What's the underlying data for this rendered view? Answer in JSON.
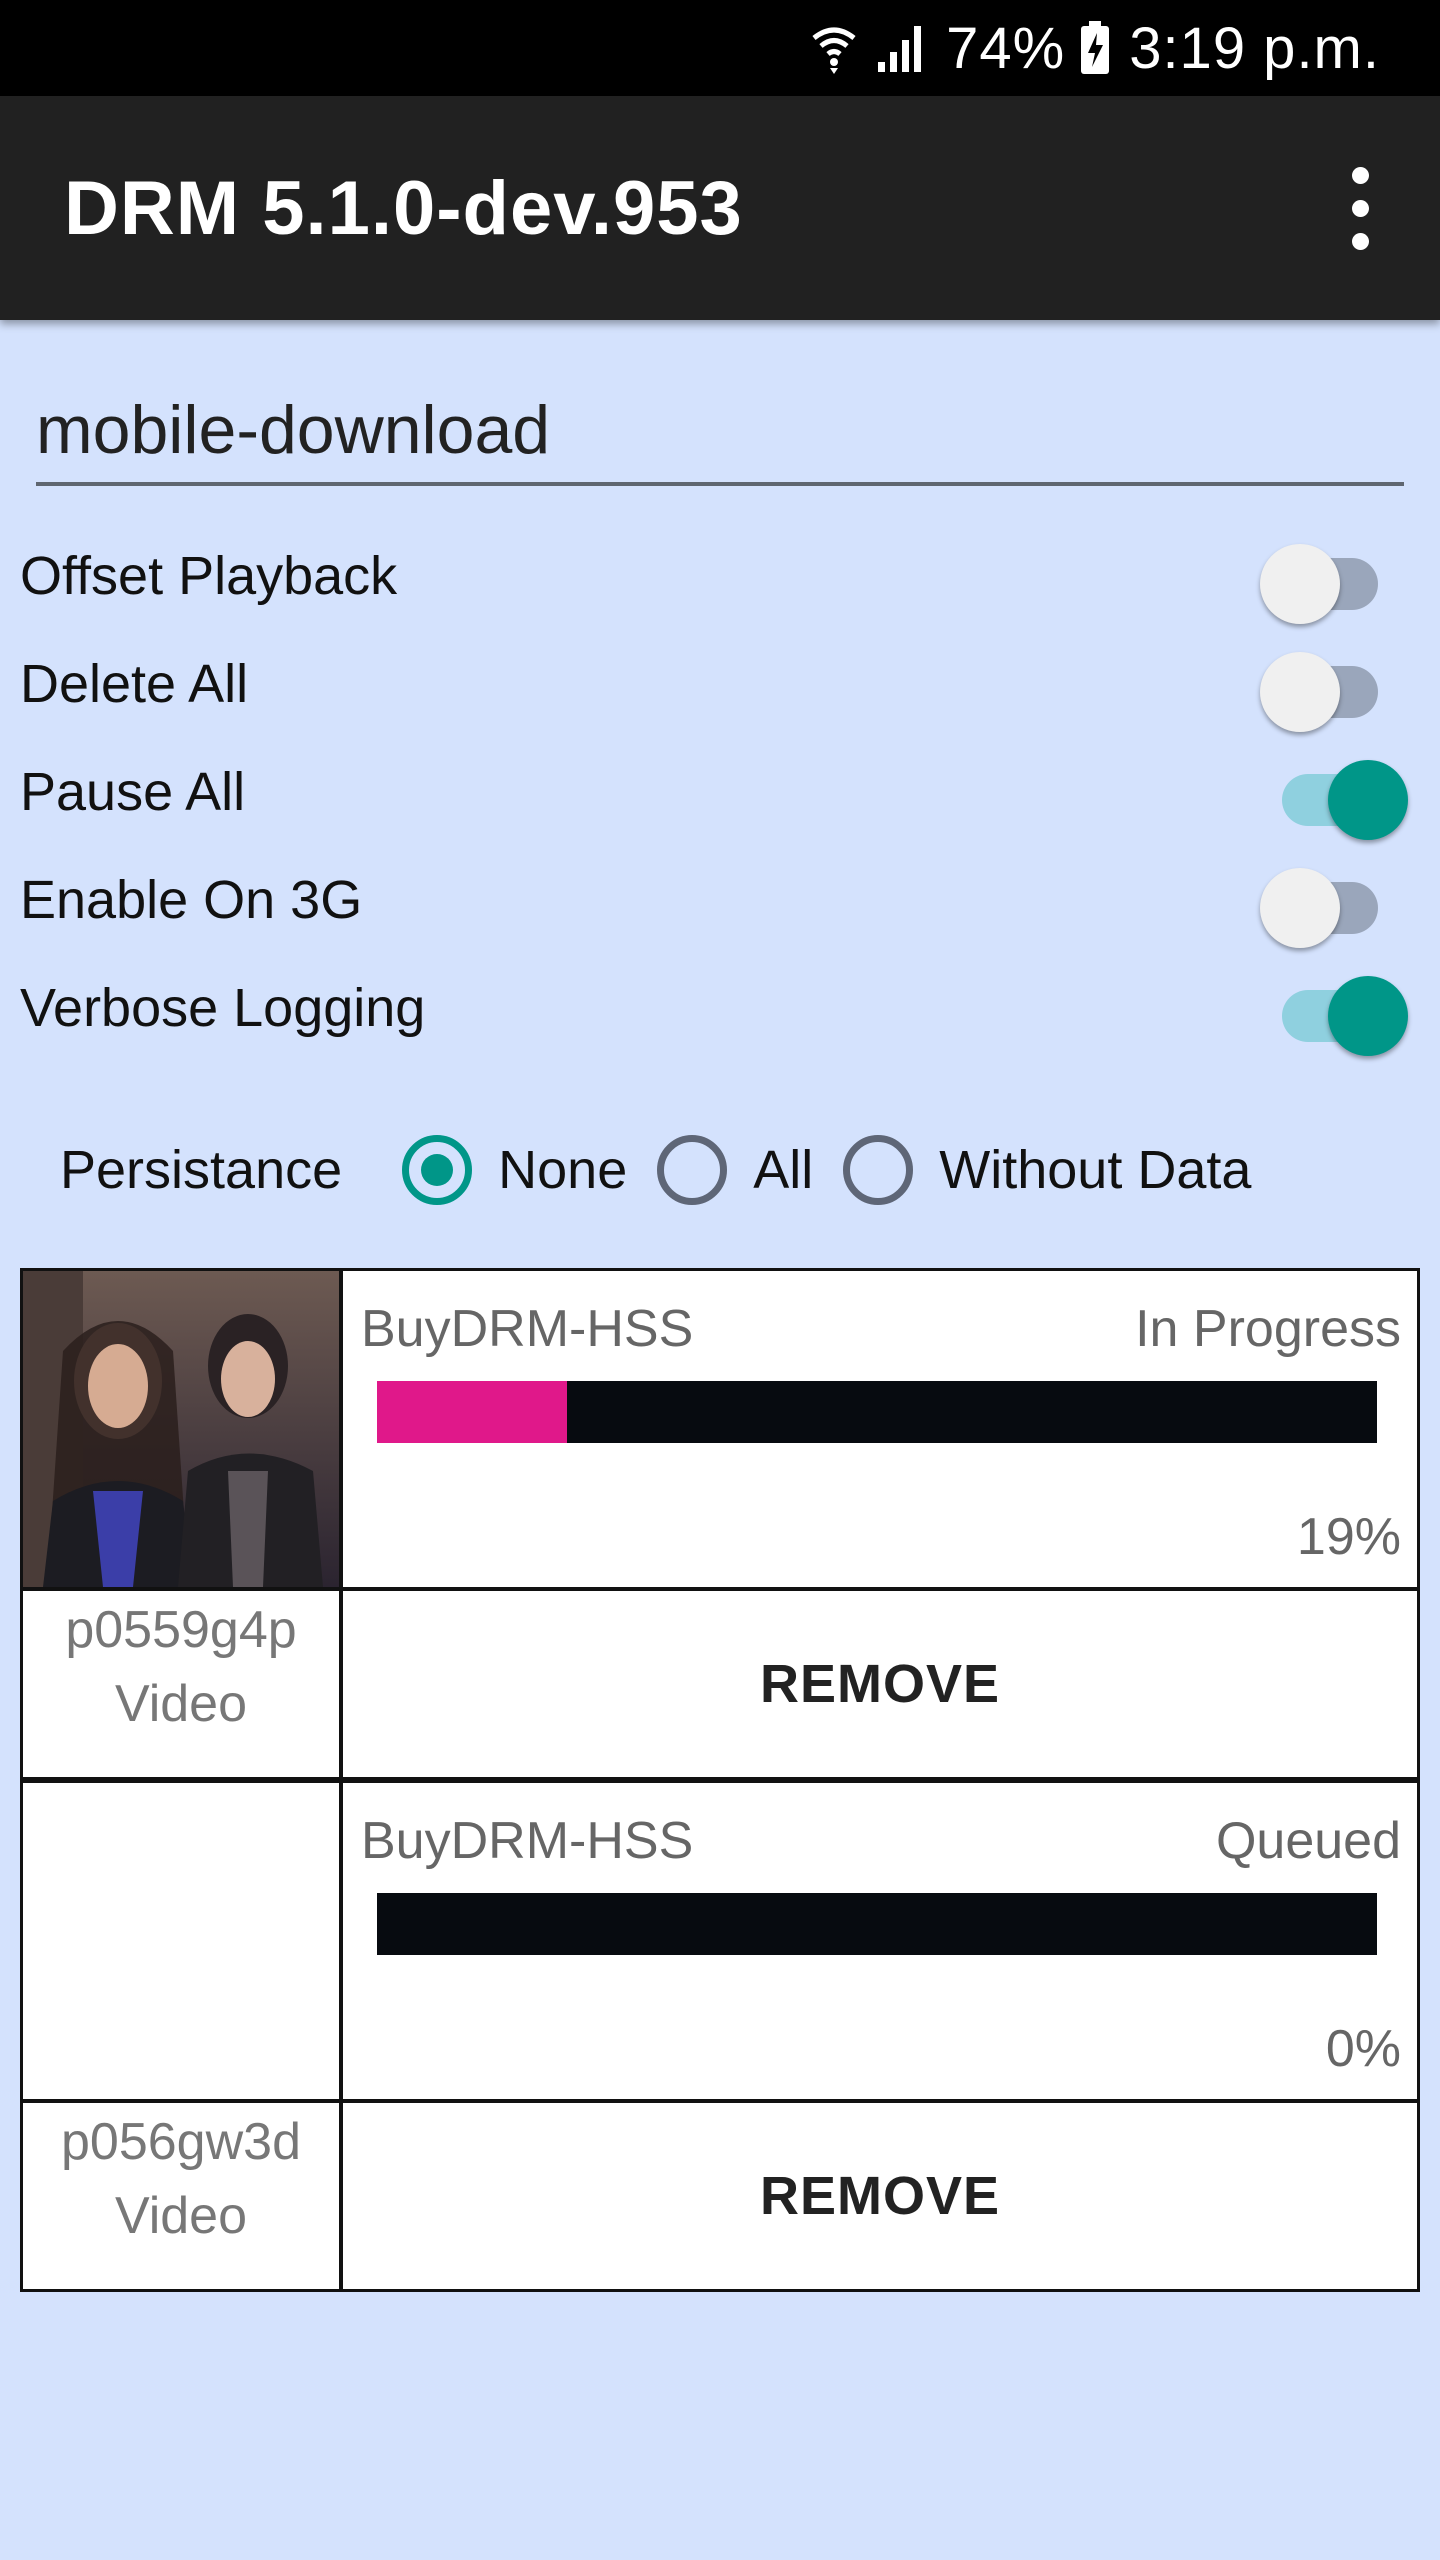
{
  "status_bar": {
    "battery": "74%",
    "time": "3:19 p.m.",
    "icons": [
      "wifi-icon",
      "signal-icon",
      "battery-charging-icon"
    ]
  },
  "app_bar": {
    "title": "DRM 5.1.0-dev.953",
    "menu_icon": "more-vert-icon"
  },
  "input": {
    "value": "mobile-download"
  },
  "settings": [
    {
      "label": "Offset Playback",
      "on": false
    },
    {
      "label": "Delete All",
      "on": false
    },
    {
      "label": "Pause All",
      "on": true
    },
    {
      "label": "Enable On 3G",
      "on": false
    },
    {
      "label": "Verbose Logging",
      "on": true
    }
  ],
  "persistence": {
    "label": "Persistance",
    "options": [
      {
        "label": "None",
        "checked": true
      },
      {
        "label": "All",
        "checked": false
      },
      {
        "label": "Without Data",
        "checked": false
      }
    ]
  },
  "downloads": [
    {
      "provider": "BuyDRM-HSS",
      "state": "In Progress",
      "progress_percent": 19,
      "progress_text": "19%",
      "id": "p0559g4p",
      "type": "Video",
      "has_thumbnail": true,
      "remove_label": "REMOVE"
    },
    {
      "provider": "BuyDRM-HSS",
      "state": "Queued",
      "progress_percent": 0,
      "progress_text": "0%",
      "id": "p056gw3d",
      "type": "Video",
      "has_thumbnail": false,
      "remove_label": "REMOVE"
    }
  ],
  "colors": {
    "background": "#d4e2fd",
    "accent": "#009688",
    "progress_fill": "#e0188a",
    "progress_track": "#070b10"
  }
}
